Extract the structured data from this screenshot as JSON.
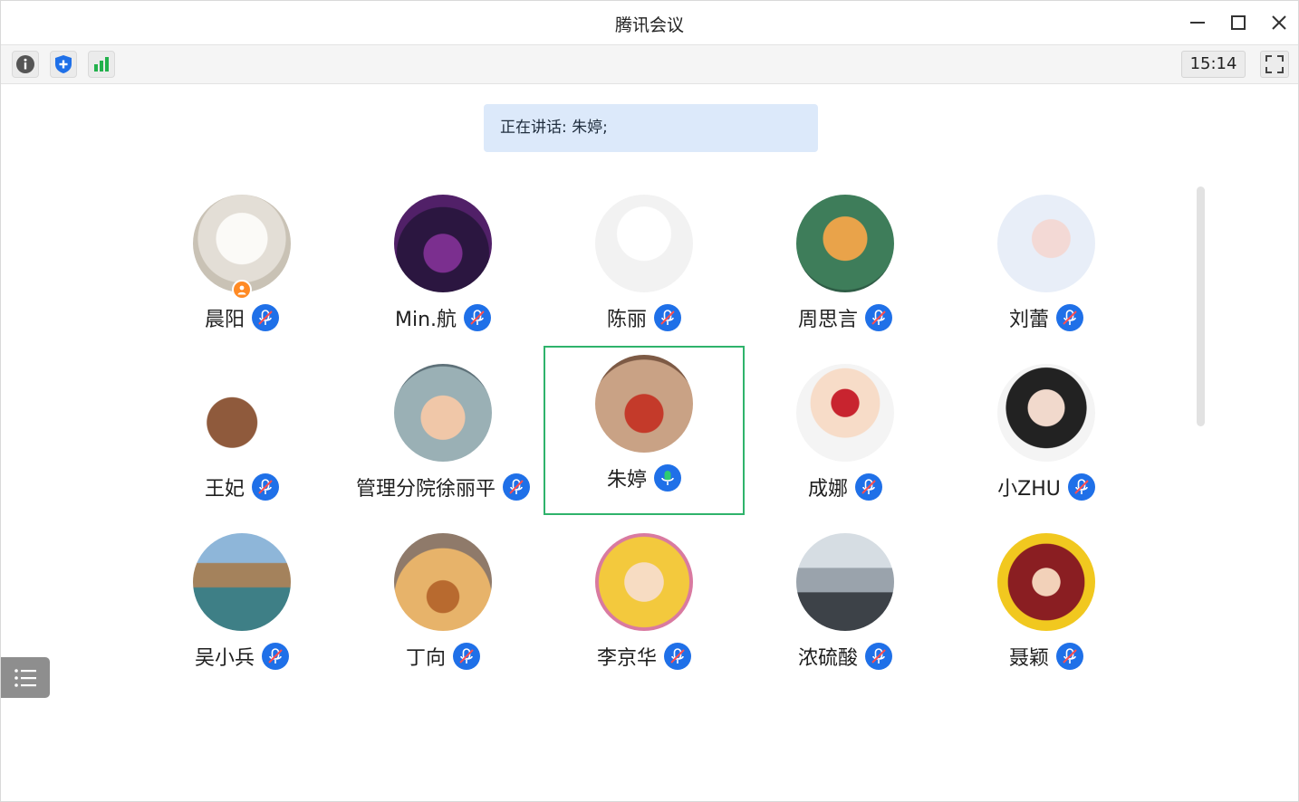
{
  "window": {
    "title": "腾讯会议"
  },
  "toolbar": {
    "info_icon": "info-icon",
    "security_icon": "shield-icon",
    "network_icon": "signal-bars-icon",
    "clock": "15:14"
  },
  "speaking": {
    "text": "正在讲话: 朱婷;"
  },
  "colors": {
    "accent": "#1f70e8",
    "active_border": "#2fb36b",
    "speaking_bg": "#dce9fa",
    "host_badge": "#ff8a24",
    "mic_on": "#2ecc71"
  },
  "participants": [
    {
      "name": "晨阳",
      "mic": "muted",
      "host": true
    },
    {
      "name": "Min.航",
      "mic": "muted"
    },
    {
      "name": "陈丽",
      "mic": "muted"
    },
    {
      "name": "周思言",
      "mic": "muted"
    },
    {
      "name": "刘蕾",
      "mic": "muted"
    },
    {
      "name": "王妃",
      "mic": "muted"
    },
    {
      "name": "管理分院徐丽平",
      "mic": "muted"
    },
    {
      "name": "朱婷",
      "mic": "on",
      "active": true
    },
    {
      "name": "成娜",
      "mic": "muted"
    },
    {
      "name": "小ZHU",
      "mic": "muted"
    },
    {
      "name": "吴小兵",
      "mic": "muted"
    },
    {
      "name": "丁向",
      "mic": "muted"
    },
    {
      "name": "李京华",
      "mic": "muted"
    },
    {
      "name": "浓硫酸",
      "mic": "muted"
    },
    {
      "name": "聂颖",
      "mic": "muted"
    }
  ]
}
